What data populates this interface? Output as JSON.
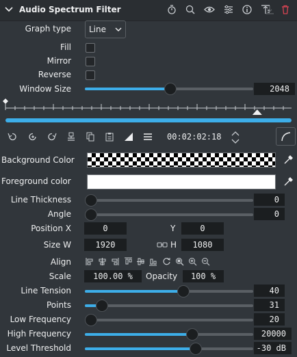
{
  "header": {
    "title": "Audio Spectrum Filter"
  },
  "graph_type": {
    "label": "Graph type",
    "value": "Line"
  },
  "fill": {
    "label": "Fill",
    "checked": false
  },
  "mirror": {
    "label": "Mirror",
    "checked": false
  },
  "reverse": {
    "label": "Reverse",
    "checked": false
  },
  "window_size": {
    "label": "Window Size",
    "value": "2048",
    "fraction": 0.51
  },
  "timeline": {
    "timecode": "00:02:02:18",
    "playhead_fraction": 0.88
  },
  "background_color": {
    "label": "Background Color"
  },
  "foreground_color": {
    "label": "Foreground color",
    "color": "#ffffff"
  },
  "line_thickness": {
    "label": "Line Thickness",
    "value": "0",
    "fraction": 0.0
  },
  "angle": {
    "label": "Angle",
    "value": "0",
    "fraction": 0.0
  },
  "position": {
    "label": "Position X",
    "x": "0",
    "y_label": "Y",
    "y": "0"
  },
  "size": {
    "label": "Size W",
    "w": "1920",
    "h_label": "H",
    "h": "1080"
  },
  "align": {
    "label": "Align"
  },
  "scale": {
    "label": "Scale",
    "value": "100.00 %",
    "opacity_label": "Opacity",
    "opacity": "100 %"
  },
  "line_tension": {
    "label": "Line Tension",
    "value": "40",
    "fraction": 0.59
  },
  "points": {
    "label": "Points",
    "value": "31",
    "fraction": 0.07
  },
  "low_frequency": {
    "label": "Low Frequency",
    "value": "20",
    "fraction": 0.0
  },
  "high_frequency": {
    "label": "High Frequency",
    "value": "20000",
    "fraction": 0.65
  },
  "level_threshold": {
    "label": "Level Threshold",
    "value": "-30 dB",
    "fraction": 0.67
  },
  "colors": {
    "accent": "#3daee9",
    "background": "#31363b",
    "field": "#1b1e20"
  }
}
